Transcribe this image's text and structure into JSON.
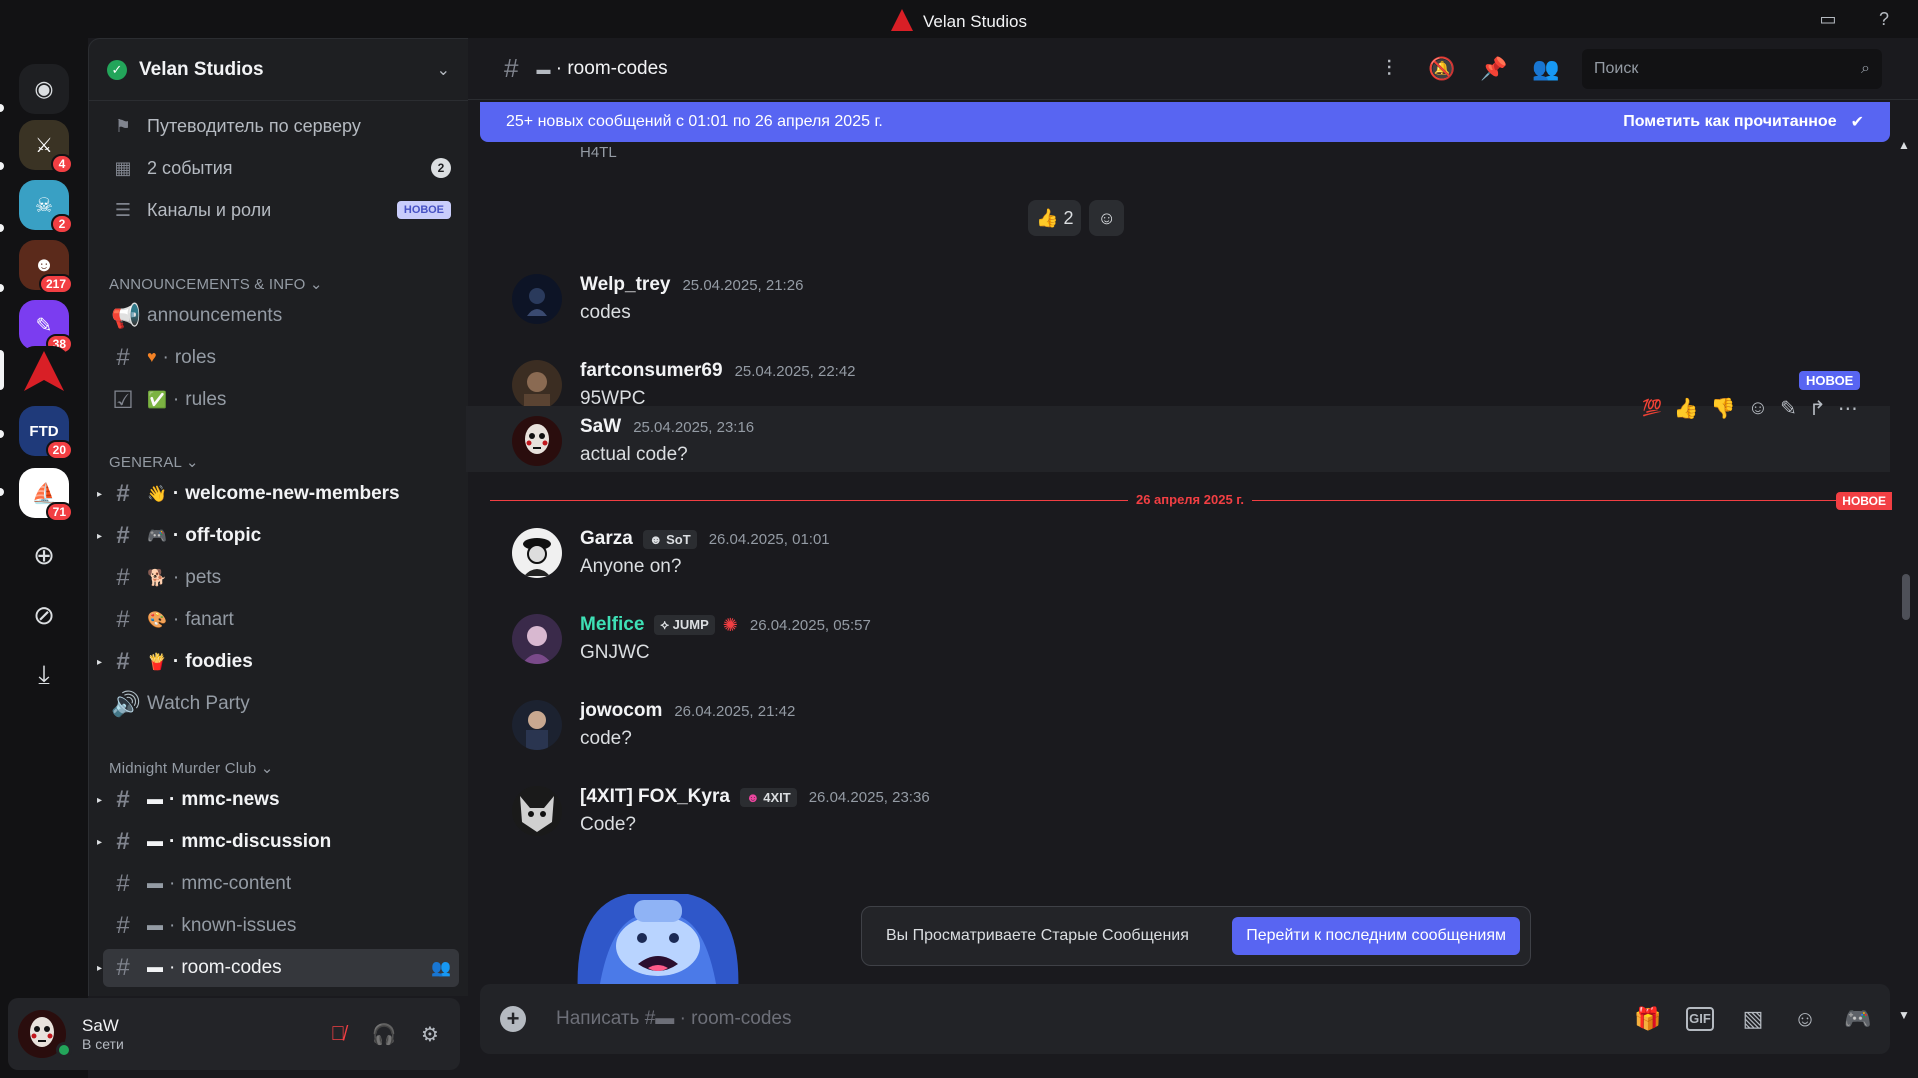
{
  "window": {
    "title": "Velan Studios"
  },
  "rail": {
    "servers": [
      {
        "name": "server-1",
        "badge": "4",
        "color": "#3a3324",
        "glyph": "⚔"
      },
      {
        "name": "server-2",
        "badge": "2",
        "color": "#39a0c4",
        "glyph": "☠"
      },
      {
        "name": "server-3",
        "badge": "217",
        "color": "#5b2a1b",
        "glyph": "☻"
      },
      {
        "name": "server-4",
        "badge": "38",
        "color": "#7b3df0",
        "glyph": "✎"
      },
      {
        "name": "server-velan",
        "badge": "",
        "color": "#121214",
        "glyph": ""
      },
      {
        "name": "server-ftd",
        "badge": "20",
        "color": "#1f3a7a",
        "glyph": "FTD"
      },
      {
        "name": "server-7",
        "badge": "71",
        "color": "#ffffff",
        "glyph": "⛵"
      }
    ]
  },
  "guild": {
    "name": "Velan Studios"
  },
  "nav": {
    "guide": "Путеводитель по серверу",
    "events": "2 события",
    "events_count": "2",
    "channels_roles": "Каналы и роли",
    "channels_roles_tag": "НОВОЕ"
  },
  "categories": {
    "announcements": "ANNOUNCEMENTS & INFO",
    "general": "GENERAL",
    "mmc": "Midnight Murder Club"
  },
  "channels": {
    "announcements": "announcements",
    "roles": "roles",
    "rules": "rules",
    "welcome": "welcome-new-members",
    "offtopic": "off-topic",
    "pets": "pets",
    "fanart": "fanart",
    "foodies": "foodies",
    "watchparty": "Watch Party",
    "mmc_news": "mmc-news",
    "mmc_discussion": "mmc-discussion",
    "mmc_content": "mmc-content",
    "known_issues": "known-issues",
    "room_codes": "room-codes"
  },
  "user": {
    "name": "SaW",
    "status": "В сети"
  },
  "header": {
    "channel": "room-codes",
    "search_placeholder": "Поиск"
  },
  "banner": {
    "text": "25+ новых сообщений с 01:01 по 26 апреля 2025 г.",
    "mark_read": "Пометить как прочитанное"
  },
  "prev_message": {
    "partial_text": "H4TL",
    "reaction_count": "2"
  },
  "messages": [
    {
      "author": "Welp_trey",
      "time": "25.04.2025, 21:26",
      "text": "codes",
      "author_color": "#f2f3f5"
    },
    {
      "author": "fartconsumer69",
      "time": "25.04.2025, 22:42",
      "text": "95WPC",
      "author_color": "#f2f3f5"
    },
    {
      "author": "SaW",
      "time": "25.04.2025, 23:16",
      "text": "actual code?",
      "author_color": "#f2f3f5"
    },
    {
      "author": "Garza",
      "tag": "SoT",
      "time": "26.04.2025, 01:01",
      "text": "Anyone on?",
      "author_color": "#f2f3f5"
    },
    {
      "author": "Melfice",
      "tag": "JUMP",
      "time": "26.04.2025, 05:57",
      "text": "GNJWC",
      "author_color": "#3ee0b5"
    },
    {
      "author": "jowocom",
      "time": "26.04.2025, 21:42",
      "text": "code?",
      "author_color": "#f2f3f5"
    },
    {
      "author": "[4XIT] FOX_Kyra",
      "tag": "4XIT",
      "time": "26.04.2025, 23:36",
      "text": "Code?",
      "author_color": "#f2f3f5"
    }
  ],
  "hover_new_tag": "НОВОЕ",
  "divider": {
    "date": "26 апреля 2025 г.",
    "tag": "НОВОЕ"
  },
  "jump": {
    "text": "Вы Просматриваете Старые Сообщения",
    "button": "Перейти к последним сообщениям"
  },
  "composer": {
    "placeholder": "Написать #▬ · room-codes"
  },
  "accent": "#5865f2"
}
